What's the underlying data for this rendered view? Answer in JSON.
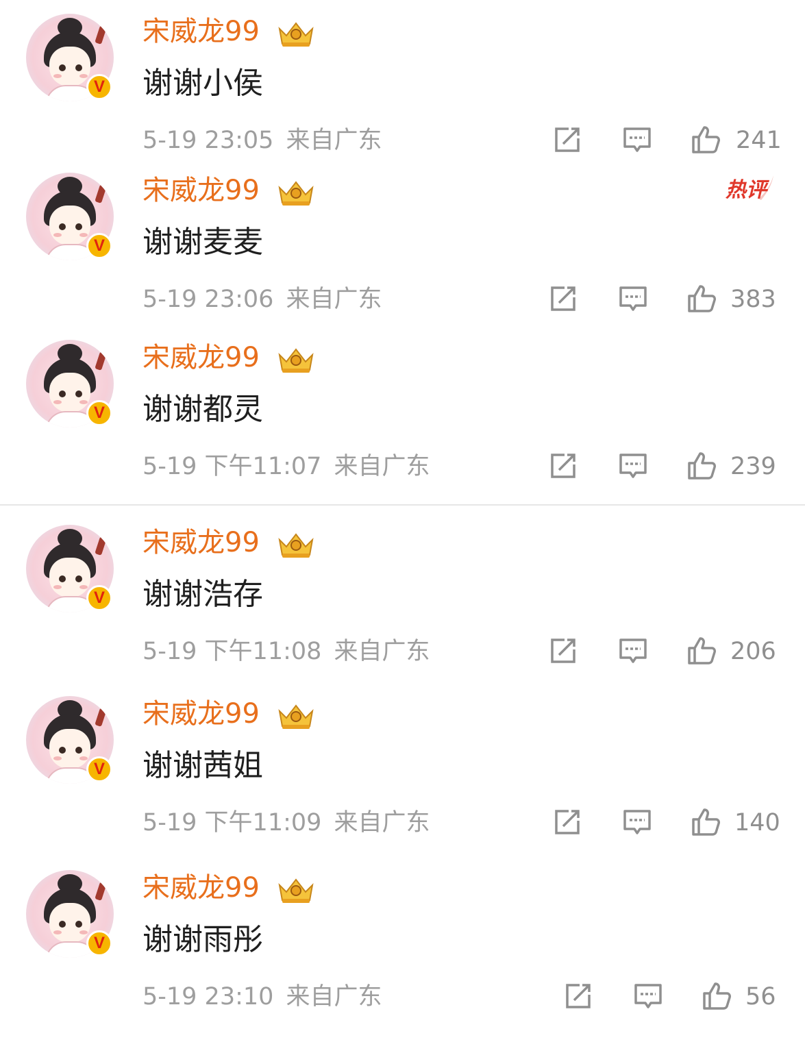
{
  "comments": [
    {
      "user": "宋威龙99",
      "text": "谢谢小侯",
      "time": "5-19 23:05",
      "location": "来自广东",
      "likes": "241",
      "hot": false
    },
    {
      "user": "宋威龙99",
      "text": "谢谢麦麦",
      "time": "5-19 23:06",
      "location": "来自广东",
      "likes": "383",
      "hot": true,
      "hot_label": "热评"
    },
    {
      "user": "宋威龙99",
      "text": "谢谢都灵",
      "time": "5-19 下午11:07",
      "location": "来自广东",
      "likes": "239",
      "hot": false
    },
    {
      "user": "宋威龙99",
      "text": "谢谢浩存",
      "time": "5-19 下午11:08",
      "location": "来自广东",
      "likes": "206",
      "hot": false
    },
    {
      "user": "宋威龙99",
      "text": "谢谢茜姐",
      "time": "5-19 下午11:09",
      "location": "来自广东",
      "likes": "140",
      "hot": false
    },
    {
      "user": "宋威龙99",
      "text": "谢谢雨彤",
      "time": "5-19 23:10",
      "location": "来自广东",
      "likes": "56",
      "hot": false
    }
  ],
  "icons": {
    "verified": "verified-v-badge-icon",
    "crown": "crown-member-icon",
    "repost": "repost-icon",
    "comment": "comment-icon",
    "like": "thumbs-up-icon"
  },
  "colors": {
    "username": "#e86f1c",
    "hot_badge": "#e0382b",
    "verified_badge": "#f7b500",
    "meta_text": "#9e9e9e"
  }
}
